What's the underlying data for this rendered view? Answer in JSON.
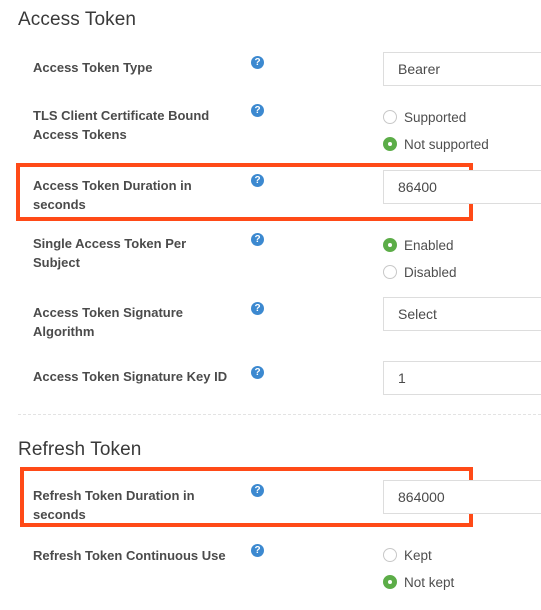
{
  "sections": {
    "access_token": {
      "title": "Access Token",
      "fields": {
        "type": {
          "label": "Access Token Type",
          "value": "Bearer"
        },
        "tls_bound": {
          "label": "TLS Client Certificate Bound Access Tokens",
          "options": [
            "Supported",
            "Not supported"
          ],
          "selected": "Not supported"
        },
        "duration": {
          "label": "Access Token Duration in seconds",
          "value": "86400"
        },
        "single_per_subject": {
          "label": "Single Access Token Per Subject",
          "options": [
            "Enabled",
            "Disabled"
          ],
          "selected": "Enabled"
        },
        "signature_algorithm": {
          "label": "Access Token Signature Algorithm",
          "value": "Select"
        },
        "signature_key_id": {
          "label": "Access Token Signature Key ID",
          "value": "1"
        }
      }
    },
    "refresh_token": {
      "title": "Refresh Token",
      "fields": {
        "duration": {
          "label": "Refresh Token Duration in seconds",
          "value": "864000"
        },
        "continuous_use": {
          "label": "Refresh Token Continuous Use",
          "options": [
            "Kept",
            "Not kept"
          ],
          "selected": "Not kept"
        }
      }
    }
  },
  "help_icon_glyph": "?",
  "colors": {
    "highlight": "#ff4a17",
    "help_icon": "#3c89d0",
    "radio_checked": "#5cad48"
  }
}
